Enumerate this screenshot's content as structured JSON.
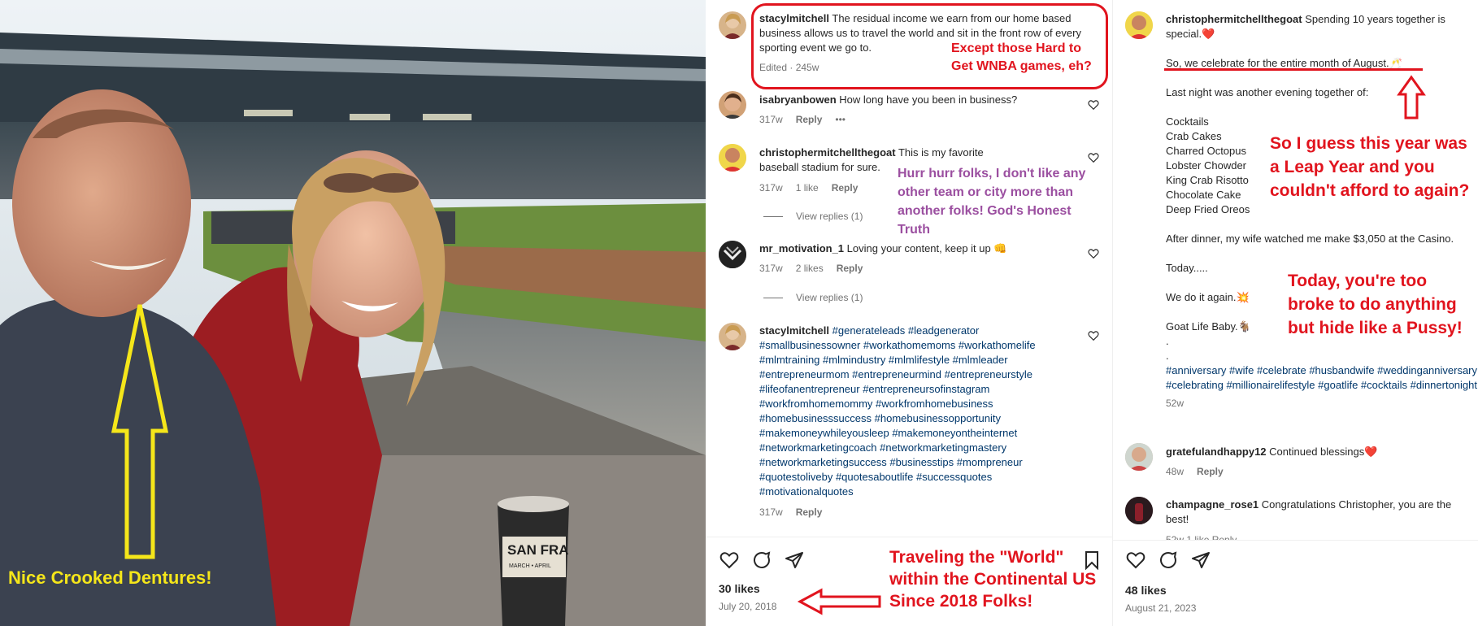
{
  "photo": {
    "cup_text": "SAN FRA",
    "cup_subtext": "MARCH • APRIL",
    "annotation": "Nice Crooked Dentures!"
  },
  "middle": {
    "comments": [
      {
        "user": "stacylmitchell",
        "text": "The residual income we earn from our home based business allows us to travel the world and sit in the front row of every sporting event we go to.",
        "meta": "Edited · 245w"
      },
      {
        "user": "isabryanbowen",
        "text": "How long have you been in business?",
        "time": "317w",
        "reply": "Reply",
        "more": "•••"
      },
      {
        "user": "christophermitchellthegoat",
        "text": "This is my favorite baseball stadium for sure.",
        "time": "317w",
        "likes": "1 like",
        "reply": "Reply",
        "view_replies": "View replies (1)"
      },
      {
        "user": "mr_motivation_1",
        "text": "Loving your content, keep it up 👊",
        "time": "317w",
        "likes": "2 likes",
        "reply": "Reply",
        "view_replies": "View replies (1)"
      },
      {
        "user": "stacylmitchell",
        "text": "#generateleads #leadgenerator #smallbusinessowner #workathomemoms #workathomelife #mlmtraining #mlmindustry #mlmlifestyle #mlmleader #entrepreneurmom #entrepreneurmind #entrepreneurstyle #lifeofanentrepreneur #entrepreneursofinstagram #workfromhomemommy #workfromhomebusiness #homebusinesssuccess #homebusinessopportunity #makemoneywhileyousleep #makemoneyontheinternet #networkmarketingcoach #networkmarketingmastery #networkmarketingsuccess #businesstips #mompreneur #quotestoliveby #quotesaboutlife #successquotes #motivationalquotes",
        "time": "317w",
        "reply": "Reply"
      }
    ],
    "annotations": {
      "wnba": "Except those Hard to Get WNBA games, eh?",
      "hurr": "Hurr hurr folks, I don't like any other team or city more than another folks! God's Honest Truth",
      "world": "Traveling the \"World\" within the Continental US Since 2018 Folks!"
    },
    "likes": "30 likes",
    "date": "July 20, 2018"
  },
  "right": {
    "caption_user": "christophermitchellthegoat",
    "caption_lines": [
      "Spending 10 years together is special.❤️",
      "So, we celebrate for the entire month of August.🥂",
      "Last night was another evening together of:",
      "Cocktails",
      "Crab Cakes",
      "Charred Octopus",
      "Lobster Chowder",
      "King Crab Risotto",
      "Chocolate Cake",
      "Deep Fried Oreos",
      "After dinner, my wife watched me make $3,050 at the Casino.",
      "Today.....",
      "We do it again.💥",
      "Goat Life Baby.🐐",
      ".",
      "."
    ],
    "hashtags": "#anniversary #wife #celebrate #husbandwife #weddinganniversary #celebrating #millionairelifestyle #goatlife #cocktails #dinnertonight #happymarriage #happywifehappilife",
    "caption_time": "52w",
    "comments": [
      {
        "user": "gratefulandhappy12",
        "text": "Continued blessings❤️",
        "time": "48w",
        "reply": "Reply"
      },
      {
        "user": "champagne_rose1",
        "text": "Congratulations Christopher, you are the best!",
        "time": "52w  1 like  Reply"
      }
    ],
    "annotations": {
      "leap": "So I guess this year was a Leap Year and you couldn't afford to again?",
      "broke": "Today, you're too broke to do anything but hide like a Pussy!"
    },
    "likes": "48 likes",
    "date": "August 21, 2023"
  },
  "colors": {
    "annotation_red": "#e1141e",
    "annotation_purple": "#9b4fa0",
    "annotation_yellow": "#f5e61a",
    "hashtag": "#00376b"
  }
}
